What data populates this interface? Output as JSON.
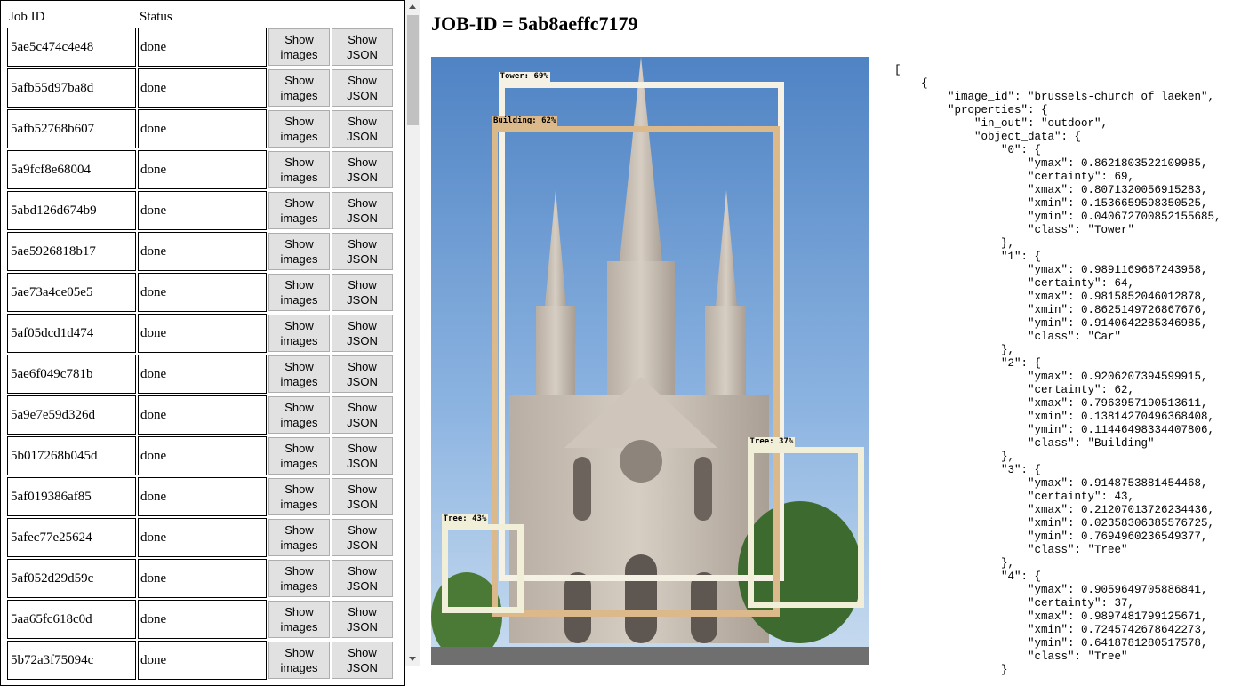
{
  "job_list": {
    "headers": {
      "job_id": "Job ID",
      "status": "Status"
    },
    "show_images_lines": [
      "Show",
      "images"
    ],
    "show_json_lines": [
      "Show",
      "JSON"
    ],
    "rows": [
      {
        "id": "5ae5c474c4e48",
        "status": "done"
      },
      {
        "id": "5afb55d97ba8d",
        "status": "done"
      },
      {
        "id": "5afb52768b607",
        "status": "done"
      },
      {
        "id": "5a9fcf8e68004",
        "status": "done"
      },
      {
        "id": "5abd126d674b9",
        "status": "done"
      },
      {
        "id": "5ae5926818b17",
        "status": "done"
      },
      {
        "id": "5ae73a4ce05e5",
        "status": "done"
      },
      {
        "id": "5af05dcd1d474",
        "status": "done"
      },
      {
        "id": "5ae6f049c781b",
        "status": "done"
      },
      {
        "id": "5a9e7e59d326d",
        "status": "done"
      },
      {
        "id": "5b017268b045d",
        "status": "done"
      },
      {
        "id": "5af019386af85",
        "status": "done"
      },
      {
        "id": "5afec77e25624",
        "status": "done"
      },
      {
        "id": "5af052d29d59c",
        "status": "done"
      },
      {
        "id": "5aa65fc618c0d",
        "status": "done"
      },
      {
        "id": "5b72a3f75094c",
        "status": "done"
      }
    ]
  },
  "job_title": "JOB-ID = 5ab8aeffc7179",
  "detections": [
    {
      "label": "Tower: 69%",
      "class": "Tower",
      "certainty": 69,
      "xmin": 0.1536659598350525,
      "xmax": 0.8071320056915283,
      "ymin": 0.040672700852155685,
      "ymax": 0.8621803522109985,
      "color": "#f5f1e4"
    },
    {
      "label": "Building: 62%",
      "class": "Building",
      "certainty": 62,
      "xmin": 0.13814270496368408,
      "xmax": 0.7963957190513611,
      "ymin": 0.11446498334407806,
      "ymax": 0.9206207394599915,
      "color": "#dcb98a"
    },
    {
      "label": "Tree: 37%",
      "class": "Tree",
      "certainty": 37,
      "xmin": 0.7245742678642273,
      "xmax": 0.9897481799125671,
      "ymin": 0.6418781280517578,
      "ymax": 0.9059649705886841,
      "color": "#f2efd9"
    },
    {
      "label": "Tree: 43%",
      "class": "Tree",
      "certainty": 43,
      "xmin": 0.02358306385576725,
      "xmax": 0.21207013726234436,
      "ymin": 0.7694960236549377,
      "ymax": 0.9148753881454468,
      "color": "#f2efd9"
    }
  ],
  "json_text": "[\n    {\n        \"image_id\": \"brussels-church of laeken\",\n        \"properties\": {\n            \"in_out\": \"outdoor\",\n            \"object_data\": {\n                \"0\": {\n                    \"ymax\": 0.8621803522109985,\n                    \"certainty\": 69,\n                    \"xmax\": 0.8071320056915283,\n                    \"xmin\": 0.1536659598350525,\n                    \"ymin\": 0.040672700852155685,\n                    \"class\": \"Tower\"\n                },\n                \"1\": {\n                    \"ymax\": 0.9891169667243958,\n                    \"certainty\": 64,\n                    \"xmax\": 0.9815852046012878,\n                    \"xmin\": 0.8625149726867676,\n                    \"ymin\": 0.9140642285346985,\n                    \"class\": \"Car\"\n                },\n                \"2\": {\n                    \"ymax\": 0.9206207394599915,\n                    \"certainty\": 62,\n                    \"xmax\": 0.7963957190513611,\n                    \"xmin\": 0.13814270496368408,\n                    \"ymin\": 0.11446498334407806,\n                    \"class\": \"Building\"\n                },\n                \"3\": {\n                    \"ymax\": 0.9148753881454468,\n                    \"certainty\": 43,\n                    \"xmax\": 0.21207013726234436,\n                    \"xmin\": 0.02358306385576725,\n                    \"ymin\": 0.7694960236549377,\n                    \"class\": \"Tree\"\n                },\n                \"4\": {\n                    \"ymax\": 0.9059649705886841,\n                    \"certainty\": 37,\n                    \"xmax\": 0.9897481799125671,\n                    \"xmin\": 0.7245742678642273,\n                    \"ymin\": 0.6418781280517578,\n                    \"class\": \"Tree\"\n                }"
}
